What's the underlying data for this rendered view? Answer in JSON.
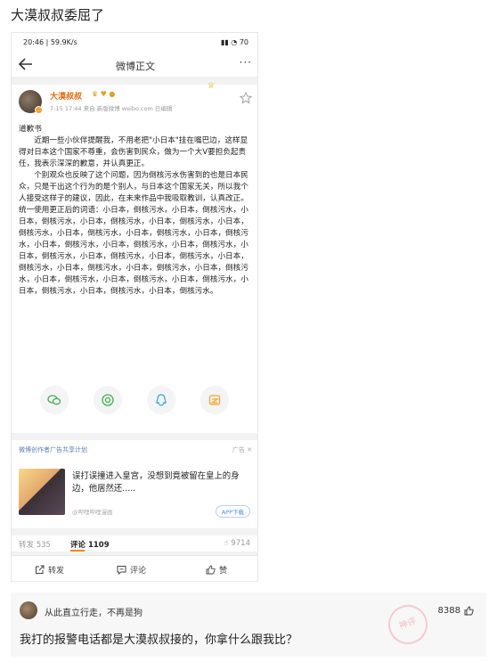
{
  "page_title": "大漠叔叔委屈了",
  "statusbar": {
    "time": "20:46 | 59.9K/s",
    "right": "70"
  },
  "navbar": {
    "title": "微博正文",
    "more": "···"
  },
  "post": {
    "username": "大漠叔叔",
    "meta": "7-15 17:44  来自 新版微博 weibo.com  已编辑",
    "paragraphs": [
      "道歉书",
      "近期一些小伙伴提醒我，不用老把\"小日本\"挂在嘴巴边，这样显得对日本这个国家不尊重，会伤害到民众，做为一个大V要担负起责任，我表示深深的歉意，并认真更正。",
      "个别观众也反映了这个问题，因为倒核污水伤害到的也是日本民众，只是干出这个行为的是个别人，与日本这个国家无关，所以我个人接受这样子的建议，因此，在未来作品中我吸取教训，认真改正。",
      "统一使用更正后的词语：小日本，倒核污水，小日本，倒核污水，小日本，倒核污水，小日本，倒核污水，小日本，倒核污水，小日本，倒核污水，小日本，倒核污水，小日本，倒核污水，小日本，倒核污水，小日本，倒核污水，小日本，倒核污水，小日本，倒核污水，小日本，倒核污水，小日本，倒核污水，小日本，倒核污水，小日本，倒核污水，小日本，倒核污水，小日本，倒核污水，小日本，倒核污水，小日本，倒核污水，小日本，倒核污水，小日本，倒核污水，小日本，倒核污水，小日本，倒核污水，小日本，倒核污水。"
    ],
    "share_icons": [
      "wechat-icon",
      "moments-icon",
      "qq-icon",
      "qzone-icon"
    ]
  },
  "ad": {
    "header": "微博创作者广告共享计划",
    "tag": "广告 ✕",
    "text": "误打误撞进入皇宫，没想到竟被留在皇上的身边，他居然还.....",
    "source": "@哔哩哔哩漫画",
    "button": "APP下载"
  },
  "stats": {
    "repost": "转发 535",
    "comment": "评论 1109",
    "like": "9714"
  },
  "actions": {
    "repost": "转发",
    "comment": "评论",
    "like": "赞"
  },
  "outer_comment": {
    "name": "从此直立行走，不再是狗",
    "likes": "8388",
    "text": "我打的报警电话都是大漠叔叔接的，你拿什么跟我比？",
    "watermark": "神评"
  },
  "colors": {
    "accent_orange": "#e86b0c",
    "link_blue": "#5b7fae"
  }
}
